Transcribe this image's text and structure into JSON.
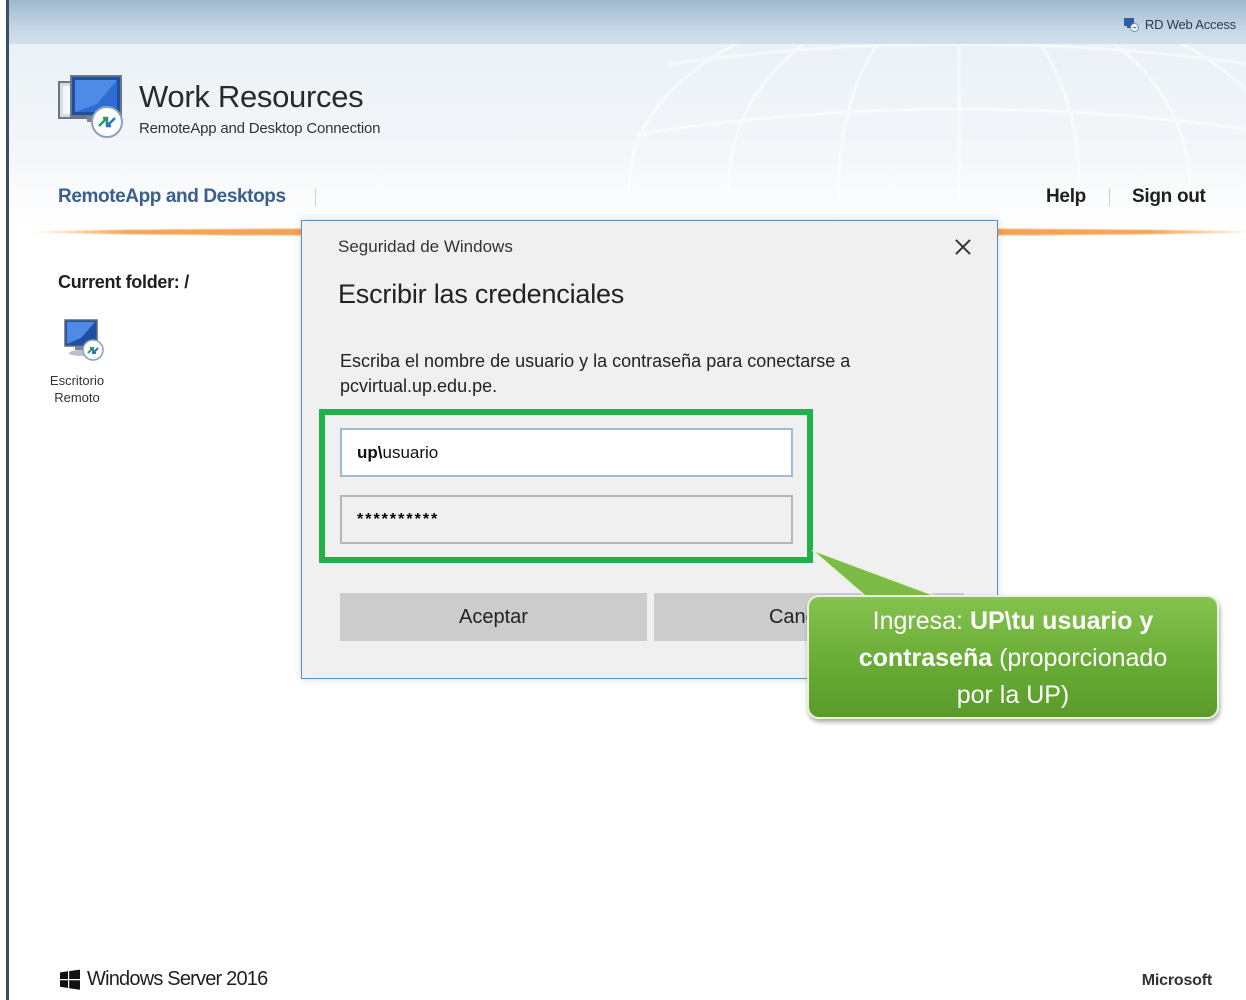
{
  "topbar": {
    "brand": "RD Web Access"
  },
  "header": {
    "title": "Work Resources",
    "subtitle": "RemoteApp and Desktop Connection"
  },
  "nav": {
    "remoteapp_label": "RemoteApp and Desktops",
    "help_label": "Help",
    "signout_label": "Sign out"
  },
  "content": {
    "folder_label": "Current folder: /",
    "items": [
      {
        "label_line1": "Escritorio",
        "label_line2": "Remoto"
      }
    ]
  },
  "dialog": {
    "caption": "Seguridad de Windows",
    "heading": "Escribir las credenciales",
    "message": "Escriba el nombre de usuario y la contraseña para conectarse a pcvirtual.up.edu.pe.",
    "username_domain": "up\\",
    "username_value": "usuario",
    "password_value": "**********",
    "ok_label": "Aceptar",
    "cancel_label": "Cancelar"
  },
  "callout": {
    "prefix": "Ingresa: ",
    "bold1": "UP\\tu usuario y",
    "bold2": "contraseña",
    "rest": " (proporcionado",
    "line3": "por la UP)"
  },
  "footer": {
    "windows_label": "Windows Server 2016",
    "ms_label": "Microsoft"
  },
  "colors": {
    "nav_link": "#3b5e8a",
    "highlight": "#22b04a",
    "callout": "#68ac35",
    "orange_rule": "#f3a052"
  }
}
